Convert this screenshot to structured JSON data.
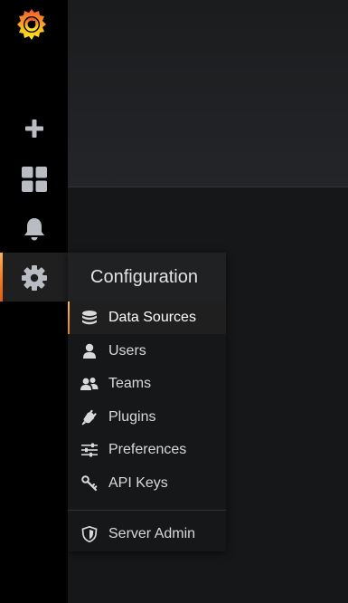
{
  "sidebar": {
    "icons": [
      {
        "name": "grafana-logo-icon"
      },
      {
        "name": "plus-icon",
        "label": "Create"
      },
      {
        "name": "dashboards-icon",
        "label": "Dashboards"
      },
      {
        "name": "bell-icon",
        "label": "Alerting"
      },
      {
        "name": "gear-icon",
        "label": "Configuration"
      }
    ]
  },
  "config_menu": {
    "title": "Configuration",
    "items": [
      {
        "label": "Data Sources",
        "icon": "database-icon"
      },
      {
        "label": "Users",
        "icon": "user-icon"
      },
      {
        "label": "Teams",
        "icon": "users-icon"
      },
      {
        "label": "Plugins",
        "icon": "plug-icon"
      },
      {
        "label": "Preferences",
        "icon": "sliders-icon"
      },
      {
        "label": "API Keys",
        "icon": "key-icon"
      }
    ],
    "admin_item": {
      "label": "Server Admin",
      "icon": "shield-icon"
    }
  },
  "colors": {
    "accent": "#eb7b18",
    "sidebar_bg": "#000000",
    "menu_bg": "#161719",
    "text": "#d8d9da"
  }
}
